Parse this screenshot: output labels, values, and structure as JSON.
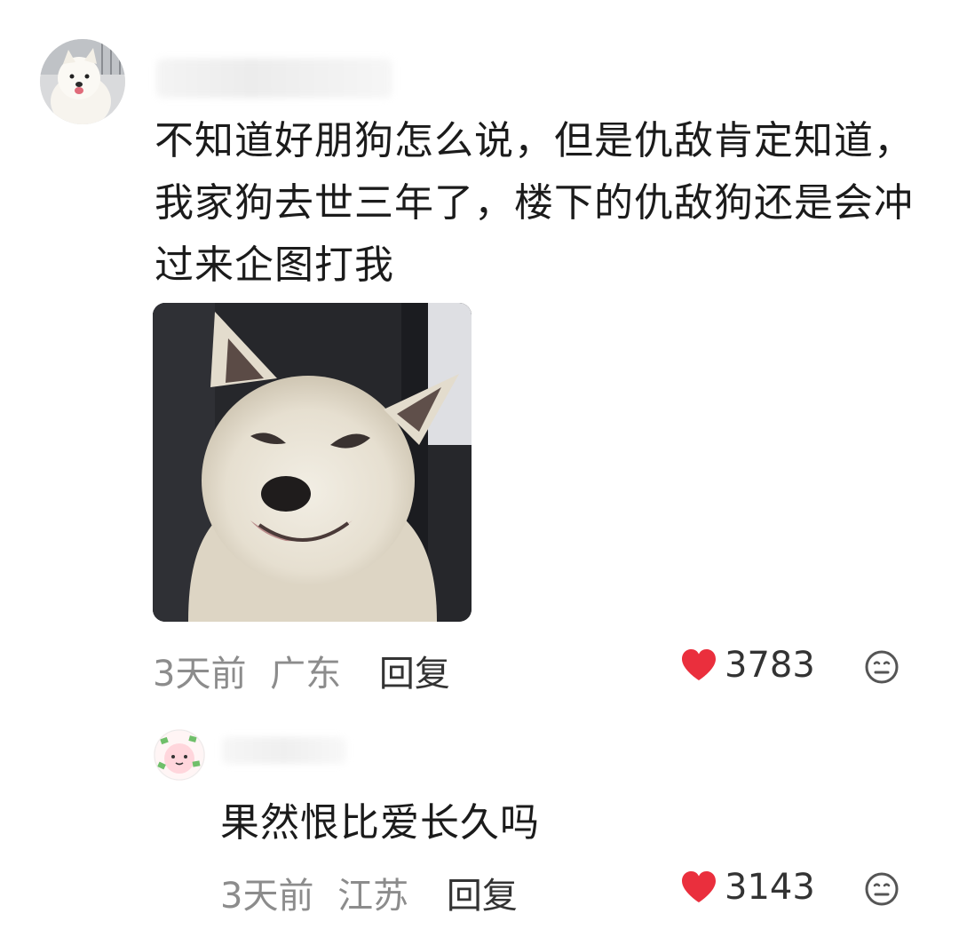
{
  "comments": [
    {
      "text": "不知道好朋狗怎么说，但是仇敌肯定知道，我家狗去世三年了，楼下的仇敌狗还是会冲过来企图打我",
      "meta_time": "3天前",
      "meta_location": "广东",
      "reply_label": "回复",
      "likes": "3783"
    },
    {
      "text": "果然恨比爱长久吗",
      "meta_time": "3天前",
      "meta_location": "江苏",
      "reply_label": "回复",
      "likes": "3143"
    }
  ],
  "icons": {
    "like": "heart-icon",
    "emoji": "neutral-face-icon"
  },
  "colors": {
    "heart": "#ea2f3d",
    "meta_gray": "#8c8c8c",
    "reply_dark": "#333333"
  }
}
